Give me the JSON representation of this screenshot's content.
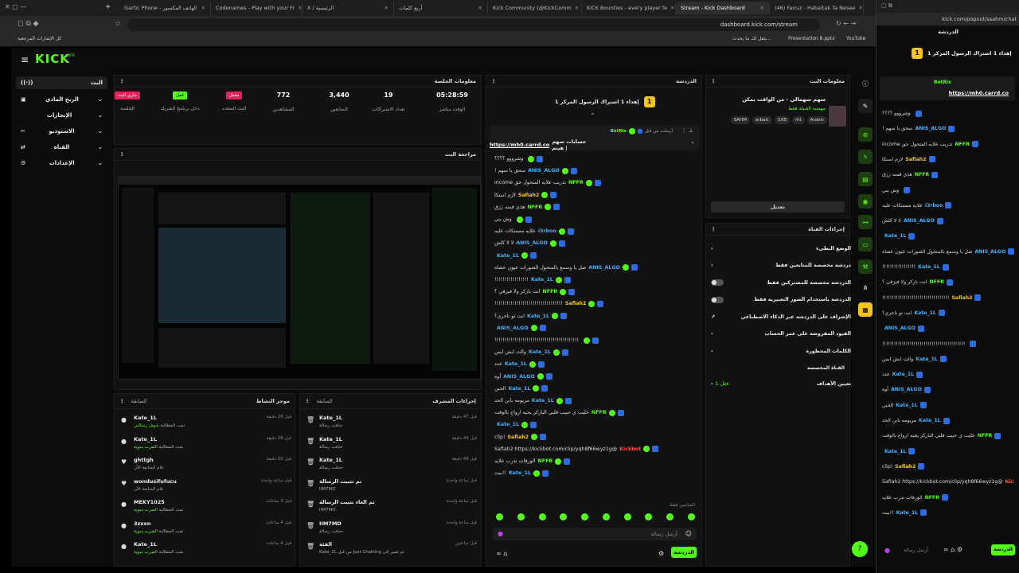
{
  "browser": {
    "tabs": [
      {
        "label": "Gartic Phone - الهاتف المكسور",
        "active": false
      },
      {
        "label": "Codenames - Play with your Fr",
        "active": false
      },
      {
        "label": "X / الرئيسية",
        "active": false
      },
      {
        "label": "أربع كلمات",
        "active": false
      },
      {
        "label": "Kick Community (@KickComm",
        "active": false
      },
      {
        "label": "KICK Bounties - every player fe",
        "active": false
      },
      {
        "label": "Stream - Kick Dashboard",
        "active": true
      },
      {
        "label": "(46) Fairuz - Habaitak Ta Nesee",
        "active": false
      }
    ],
    "url": "dashboard.kick.com/stream",
    "bookmarks": {
      "all": "كل الإشارات المرجعية",
      "b1": "بتقل لك ما يحدث...",
      "b2": "Presentation 8.pptx",
      "b3": "YouTube"
    }
  },
  "header": {
    "logo": "KICK",
    "logo_sub": "BETA"
  },
  "sidebar": {
    "items": [
      {
        "label": "البث",
        "icon": "broadcast-icon"
      },
      {
        "label": "الربح المادي",
        "icon": "money-icon"
      },
      {
        "label": "الإنجازات",
        "icon": "trophy-icon"
      },
      {
        "label": "الاستوديو",
        "icon": "studio-icon"
      },
      {
        "label": "القناة",
        "icon": "channel-icon"
      },
      {
        "label": "الإعدادات",
        "icon": "gear-icon"
      }
    ]
  },
  "session": {
    "title": "معلومات الجلسة",
    "stats": [
      {
        "value": "05:28:59",
        "label": "الوقت مباشر"
      },
      {
        "value": "19",
        "label": "تعداد الاشتراكات"
      },
      {
        "value": "3,440",
        "label": "المتابعين"
      },
      {
        "value": "772",
        "label": "المشاهدين"
      },
      {
        "value": "مفعل",
        "label": "البث المتعدد",
        "badge": "#e0245e"
      },
      {
        "value": "فعل",
        "label": "دخل برنامج الشريك",
        "badge": "#53fc18"
      },
      {
        "value": "جاري البث",
        "label": "الجلسة",
        "badge": "#e0245e"
      }
    ]
  },
  "preview": {
    "title": "مراجعة البث"
  },
  "activity": {
    "title": "موجز النشاط",
    "subtitle": "السابقة",
    "rows": [
      {
        "name": "Kate_1L",
        "desc": "تمت المطالبة",
        "tag": "شوف رسالتي",
        "time": "قبل 26 دقيقة"
      },
      {
        "name": "Kate_1L",
        "desc": "تمت المطالبة",
        "tag": "الضرب سوية",
        "time": "قبل 26 دقيقة"
      },
      {
        "name": "ghttgh",
        "desc": "قام المتابعة الآن",
        "tag": "",
        "time": "قبل 50 دقيقة"
      },
      {
        "name": "wondusifufucu",
        "desc": "قام المتابعة الآن",
        "tag": "",
        "time": "قبل ساعة واحدة"
      },
      {
        "name": "MEKY1025",
        "desc": "تمت المطالبة",
        "tag": "الضرب سوية",
        "time": "قبل 3 ساعات"
      },
      {
        "name": "3zxxn",
        "desc": "تمت المطالبة",
        "tag": "الضرب سوية",
        "time": "قبل 4 ساعات"
      },
      {
        "name": "Kate_1L",
        "desc": "تمت المطالبة",
        "tag": "الضرب سوية",
        "time": "قبل 4 ساعات"
      }
    ]
  },
  "modactions": {
    "title": "إجراءات المشرف",
    "subtitle": "السابقة",
    "rows": [
      {
        "name": "Kate_1L",
        "desc": "حذفت رسالة",
        "time": "قبل 47 دقيقة"
      },
      {
        "name": "Kate_1L",
        "desc": "حذفت رسالة",
        "time": "قبل 49 دقيقة"
      },
      {
        "name": "Kate_1L",
        "desc": "حذفت رسالة",
        "time": "قبل 49 دقيقة"
      },
      {
        "name": "تم تثبيت الرسالة",
        "desc": "IIM7MD",
        "time": "قبل ساعة واحدة"
      },
      {
        "name": "تم الغاء تثبيت الرسالة",
        "desc": "IIM7MD",
        "time": "قبل ساعة واحدة"
      },
      {
        "name": "IIM7MD",
        "desc": "حذفت رسالة",
        "time": "قبل ساعة واحدة"
      },
      {
        "name": "الفئة",
        "desc": "Kate_1L من قبل Just Chatting تم تغيير إلى",
        "time": "قبل ساعتين"
      }
    ]
  },
  "chat": {
    "title": "الدردشة",
    "top_gifter": "1 إهداء 1 اشتراك الرسول المركز",
    "pinned_by": "أرسلت من قبل",
    "pinned_user": "BotRix",
    "pinned_text": "حسابات سهم هيثم |",
    "pinned_link": "https://mh0.carrd.co",
    "messages": [
      {
        "user": "",
        "text": "وشرووو ؟؟؟؟",
        "color": ""
      },
      {
        "user": "ANIS_ALGO",
        "text": "سحق يا سهم !",
        "color": "b"
      },
      {
        "user": "NFFR",
        "text": "تدريب علايه المتحول حق income",
        "color": "g"
      },
      {
        "user": "Safiah2",
        "text": "لازم استكا",
        "color": "y"
      },
      {
        "user": "NFFR",
        "text": "هذي قمته رزق",
        "color": "g"
      },
      {
        "user": "",
        "text": "وش يبي",
        "color": ""
      },
      {
        "user": "i3rboo",
        "text": "علايه مستنكات عليه",
        "color": ""
      },
      {
        "user": "ANIS_ALGO",
        "text": "لا لا كلش",
        "color": "b"
      },
      {
        "user": "Kate_1L",
        "text": "",
        "color": "b"
      },
      {
        "user": "ANIS_ALGO",
        "text": "صل يا وسمع بالمتحول الصورات عيون عشاه",
        "color": "b"
      },
      {
        "user": "Kate_1L",
        "text": "!!!!!!!!!!!!!!!!!",
        "color": "b"
      },
      {
        "user": "NFFR",
        "text": "انت باركر ولا فيزقي ؟",
        "color": "g"
      },
      {
        "user": "Safiah2",
        "text": "!!!!!!!!!!!!!!!!!!!!!!!!!!!!!!!!!!",
        "color": "y"
      },
      {
        "user": "Kate_1L",
        "text": "انت تو ناخري؟",
        "color": "b"
      },
      {
        "user": "ANIS_ALGO",
        "text": "",
        "color": "b"
      },
      {
        "user": "",
        "text": "!!!!!!!!!!!!!!!!!!!!!!!!!!!!!!!!!!!!!!!!!!",
        "color": ""
      },
      {
        "user": "Kate_1L",
        "text": "والت ابش ابس",
        "color": "b"
      },
      {
        "user": "Kate_1L",
        "text": "عدد",
        "color": "b"
      },
      {
        "user": "ANIS_ALGO",
        "text": "أوه",
        "color": "b"
      },
      {
        "user": "Kate_1L",
        "text": "الحين",
        "color": "b"
      },
      {
        "user": "Kate_1L",
        "text": "مريومه بابن الحد",
        "color": "b"
      },
      {
        "user": "NFFR",
        "text": "خليب ي حبيب قلبي الباركر يجيه ارواح بالوقت",
        "color": "g"
      },
      {
        "user": "Kate_1L",
        "text": "",
        "color": "b"
      },
      {
        "user": "Safiah2",
        "text": "!clip",
        "color": "y"
      },
      {
        "user": "Kickbot",
        "text": "@Safiah2 https://kickbot.com/clip/yqh8f66wyz1g",
        "color": "r"
      },
      {
        "user": "NFFR",
        "text": "الورقات تدرب علايه",
        "color": "g"
      },
      {
        "user": "Kate_1L",
        "text": "!!بيت",
        "color": "b"
      }
    ],
    "mods_only": "المتابعين فقط",
    "input_placeholder": "أرسل رسالة",
    "send_label": "الدردشة"
  },
  "stream_info": {
    "title": "معلومات البث",
    "stream_title": "سهم سهمالي - من الواقت يمكن",
    "category": "مهمتية القنبلة فقط",
    "tags": [
      "Arabic",
      "mt",
      "SXB",
      "arbaic",
      "SAHM"
    ],
    "edit_label": "تعديل"
  },
  "channel_actions": {
    "title": "إجراءات القناة",
    "rows": [
      {
        "label": "الوضع البطيء",
        "type": "arrow"
      },
      {
        "label": "دردشة مخصصة للمتابعين فقط",
        "type": "arrow"
      },
      {
        "label": "الدردشة مخصصة للمشتركين فقط",
        "type": "toggle"
      },
      {
        "label": "الدردشة باستخدام الصور التعبيرية فقط",
        "type": "toggle"
      },
      {
        "label": "الإشراف على الدردشة عبر الذكاء الاصطناعي",
        "type": "link"
      },
      {
        "label": "القيود المفروضة على عمر الحساب",
        "type": "arrow"
      },
      {
        "label": "الكلمات المحظورة",
        "type": "arrow"
      }
    ],
    "goals_header": "القناة المخصصة",
    "goals_label": "تعيين الأهداف",
    "goals_status": "فعل 1"
  },
  "popout": {
    "url": "kick.com/popout/ssahm/chat",
    "title": "الدردشة",
    "send_label": "الدردشة",
    "placeholder": "أرسل رسالة"
  }
}
